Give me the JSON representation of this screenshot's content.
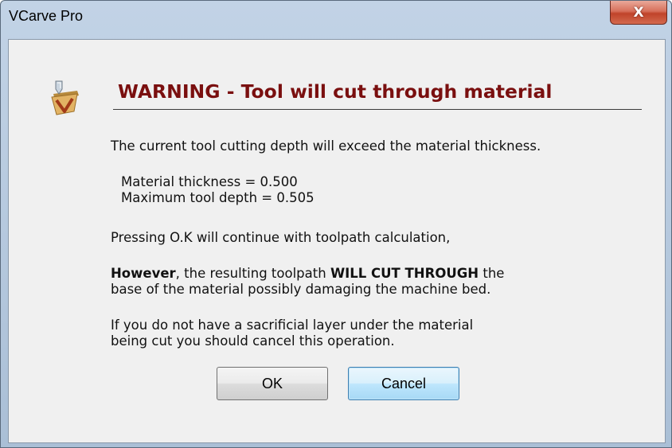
{
  "window": {
    "title": "VCarve Pro",
    "close_glyph": "X"
  },
  "dialog": {
    "icon": "vcarve-app-icon",
    "heading": "WARNING - Tool will cut through material",
    "line1": "The current tool cutting depth will exceed the material thickness.",
    "material_thickness": "Material thickness = 0.500",
    "max_tool_depth": "Maximum tool depth = 0.505",
    "continue_note": "Pressing O.K will continue with toolpath calculation,",
    "however_bold": "However",
    "however_mid": ", the resulting toolpath ",
    "cut_through_bold": "WILL CUT THROUGH",
    "however_end": " the",
    "however_line2": "base of the material possibly damaging the machine bed.",
    "sacrificial_line1": "If you do not have a sacrificial layer under the material",
    "sacrificial_line2": "being cut you should cancel this operation."
  },
  "buttons": {
    "ok": "OK",
    "cancel": "Cancel"
  },
  "colors": {
    "heading": "#7a0f0f",
    "close_button": "#c0432a",
    "default_button": "#a7d9f5"
  }
}
